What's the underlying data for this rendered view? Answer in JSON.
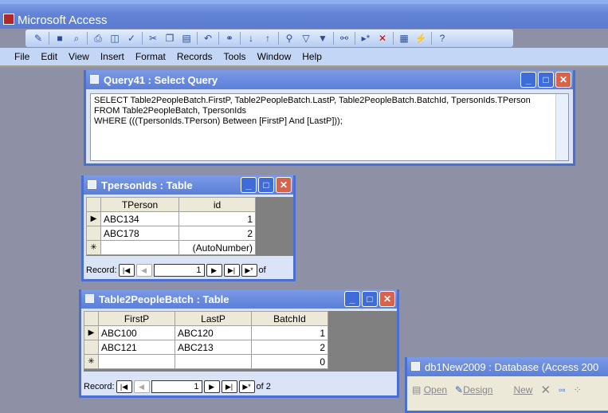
{
  "app": {
    "title": "Microsoft Access"
  },
  "menu": [
    "File",
    "Edit",
    "View",
    "Insert",
    "Format",
    "Records",
    "Tools",
    "Window",
    "Help"
  ],
  "query": {
    "title": "Query41 : Select Query",
    "sql": [
      "SELECT Table2PeopleBatch.FirstP, Table2PeopleBatch.LastP, Table2PeopleBatch.BatchId, TpersonIds.TPerson",
      "FROM Table2PeopleBatch, TpersonIds",
      "WHERE (((TpersonIds.TPerson) Between [FirstP] And [LastP]));"
    ]
  },
  "tperson": {
    "title": "TpersonIds : Table",
    "headers": [
      "TPerson",
      "id"
    ],
    "rows": [
      [
        "ABC134",
        "1"
      ],
      [
        "ABC178",
        "2"
      ]
    ],
    "new_row": [
      "",
      "(AutoNumber)"
    ],
    "record_label": "Record:",
    "record": "1",
    "of": "of"
  },
  "batch": {
    "title": "Table2PeopleBatch : Table",
    "headers": [
      "FirstP",
      "LastP",
      "BatchId"
    ],
    "rows": [
      [
        "ABC100",
        "ABC120",
        "1"
      ],
      [
        "ABC121",
        "ABC213",
        "2"
      ]
    ],
    "new_row": [
      "",
      "",
      "0"
    ],
    "record_label": "Record:",
    "record": "1",
    "of": "of 2"
  },
  "db": {
    "title": "db1New2009 : Database (Access 200",
    "open": "Open",
    "design": "Design",
    "new": "New"
  }
}
